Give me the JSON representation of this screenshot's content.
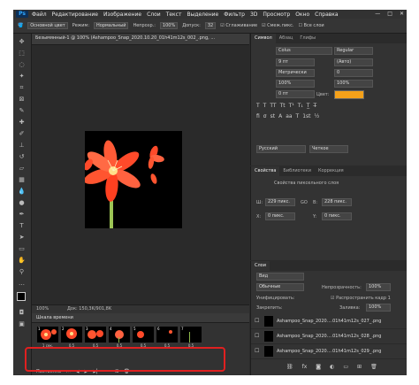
{
  "menu": {
    "app_logo": "Ps",
    "items": [
      "Файл",
      "Редактирование",
      "Изображение",
      "Слои",
      "Текст",
      "Выделение",
      "Фильтр",
      "3D",
      "Просмотр",
      "Окно",
      "Справка"
    ],
    "window_controls": [
      "—",
      "□",
      "✕"
    ]
  },
  "options": {
    "source_label": "Основной цвет",
    "mode_label": "Режим:",
    "mode_value": "Нормальный",
    "opacity_label": "Непрозр.:",
    "opacity_value": "100%",
    "tolerance_label": "Допуск:",
    "tolerance_value": "32",
    "antialias_label": "Сглаживание",
    "contiguous_label": "Смеж.пикс.",
    "all_layers_label": "Все слои"
  },
  "document": {
    "tab_title": "Безымянный-1 @ 100% (Ashampoo_Snap_2020.10.20_01h41m12s_002_.png, ...",
    "zoom": "100%",
    "doc_info": "Док: 150,3K/901,8K"
  },
  "timeline": {
    "title": "Шкала времени",
    "frames": [
      {
        "num": "1",
        "delay": "1 сек."
      },
      {
        "num": "2",
        "delay": "0,5"
      },
      {
        "num": "3",
        "delay": "0,5"
      },
      {
        "num": "4",
        "delay": "0,5"
      },
      {
        "num": "5",
        "delay": "0,5"
      },
      {
        "num": "6",
        "delay": "0,5"
      },
      {
        "num": "7",
        "delay": "0,5"
      }
    ],
    "loop_label": "Постоянно"
  },
  "symbol_panel": {
    "tabs": [
      "Символ",
      "Абзац",
      "Глифы"
    ],
    "font_family": "Colus",
    "font_style": "Regular",
    "font_size": "9 пт",
    "leading": "(Авто)",
    "kerning": "Метрически",
    "tracking": "0",
    "vscale": "100%",
    "hscale": "100%",
    "baseline": "0 пт",
    "color_label": "Цвет:",
    "color_value": "#f5a11a",
    "language": "Русский",
    "aa": "Четкое"
  },
  "properties_panel": {
    "tabs": [
      "Свойства",
      "Библиотеки",
      "Коррекция"
    ],
    "subtitle": "Свойства пиксельного слоя",
    "w_label": "Ш:",
    "w_value": "229 пикс.",
    "go_label": "GO",
    "h_label": "В:",
    "h_value": "228 пикс.",
    "x_label": "X:",
    "x_value": "0 пикс.",
    "y_label": "Y:",
    "y_value": "0 пикс."
  },
  "layers_panel": {
    "tabs": [
      "Слои"
    ],
    "kind_filter": "Вид",
    "blend_mode": "Обычные",
    "opacity_label": "Непрозрачность:",
    "opacity_value": "100%",
    "unify_label": "Унифицировать:",
    "propagate_label": "Распространить кадр 1",
    "lock_label": "Закрепить:",
    "fill_label": "Заливка:",
    "fill_value": "100%",
    "layers": [
      "Ashampoo_Snap_2020....01h41m12s_027_.png",
      "Ashampoo_Snap_2020....01h41m12s_028_.png",
      "Ashampoo_Snap_2020....01h41m12s_029_.png"
    ]
  },
  "colors": {
    "accent": "#31a8ff",
    "highlight": "#e02020",
    "petal": "#ff4a2a",
    "stem": "#8cb84a"
  }
}
